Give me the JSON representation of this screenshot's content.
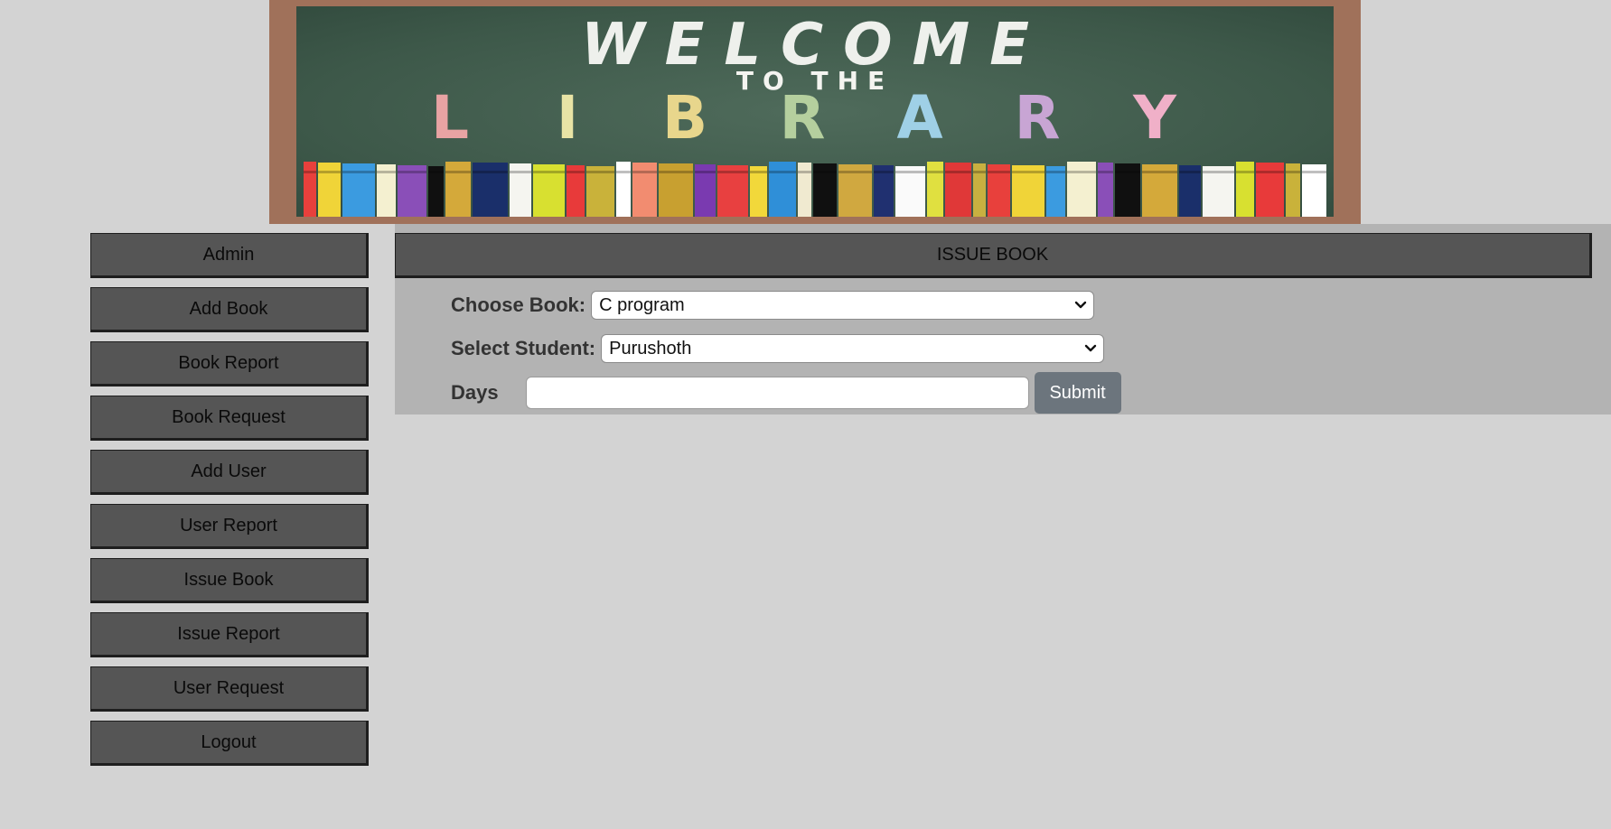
{
  "banner": {
    "line1": "WELCOME",
    "line2": "TO THE",
    "line3_letters": [
      "L",
      "I",
      "B",
      "R",
      "A",
      "R",
      "Y"
    ],
    "line3_colors": [
      "#e8a3a3",
      "#e8e3a5",
      "#e8d68c",
      "#b5cf9e",
      "#9fd0e6",
      "#c8a5d4",
      "#f0b0c8"
    ],
    "book_colors": [
      "#e8403c",
      "#f0d438",
      "#3b9be0",
      "#f4f0d0",
      "#8a4fb8",
      "#101010",
      "#d4a93a",
      "#1a2f6a",
      "#f5f5f0",
      "#d8e030",
      "#e83a3a",
      "#c9b23a",
      "#ffffff",
      "#f28c70",
      "#c8a030",
      "#7a3ab0",
      "#e84040",
      "#f2d83a",
      "#2f8fd8",
      "#f0ead0",
      "#101010",
      "#d0a840",
      "#203070",
      "#fafafa",
      "#e0e040",
      "#e03838",
      "#c8b040"
    ]
  },
  "sidebar": {
    "items": [
      {
        "label": "Admin"
      },
      {
        "label": "Add Book"
      },
      {
        "label": "Book Report"
      },
      {
        "label": "Book Request"
      },
      {
        "label": "Add User"
      },
      {
        "label": "User Report"
      },
      {
        "label": "Issue Book"
      },
      {
        "label": "Issue Report"
      },
      {
        "label": "User Request"
      },
      {
        "label": "Logout"
      }
    ]
  },
  "main": {
    "header": "ISSUE BOOK",
    "form": {
      "book_label": "Choose Book:",
      "book_value": "C program",
      "student_label": "Select Student:",
      "student_value": "Purushoth",
      "days_label": "Days",
      "days_value": "",
      "submit_label": "Submit"
    }
  },
  "colors": {
    "page_bg": "#d3d3d3",
    "nav_bg": "#555555",
    "panel_bg": "#b3b3b3",
    "submit_bg": "#6c757d"
  }
}
